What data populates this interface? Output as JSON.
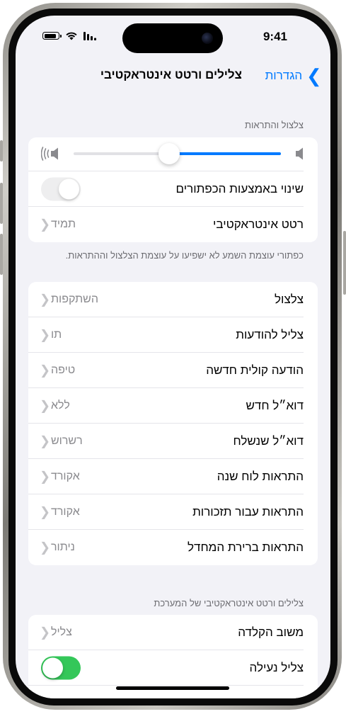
{
  "status_bar": {
    "time": "9:41"
  },
  "nav": {
    "back_label": "הגדרות",
    "title": "צלילים ורטט אינטראקטיבי"
  },
  "ringer_section": {
    "header": "צלצול והתראות",
    "volume_level": 0.46,
    "change_with_buttons": {
      "label": "שינוי באמצעות הכפתורים",
      "on": false
    },
    "haptics": {
      "label": "רטט אינטראקטיבי",
      "value": "תמיד"
    },
    "footer": "כפתורי עוצמת השמע לא ישפיעו על עוצמת הצלצול וההתראות."
  },
  "sounds_section": {
    "items": [
      {
        "label": "צלצול",
        "value": "השתקפות"
      },
      {
        "label": "צליל להודעות",
        "value": "תו"
      },
      {
        "label": "הודעה קולית חדשה",
        "value": "טיפה"
      },
      {
        "label": "דוא״ל חדש",
        "value": "ללא"
      },
      {
        "label": "דוא״ל שנשלח",
        "value": "רשרוש"
      },
      {
        "label": "התראות לוח שנה",
        "value": "אקורד"
      },
      {
        "label": "התראות עבור תזכורות",
        "value": "אקורד"
      },
      {
        "label": "התראות ברירת המחדל",
        "value": "ניתור"
      }
    ]
  },
  "system_section": {
    "header": "צלילים ורטט אינטראקטיבי של המערכת",
    "keyboard_feedback": {
      "label": "משוב הקלדה",
      "value": "צליל"
    },
    "lock_sound": {
      "label": "צליל נעילה",
      "on": true
    }
  },
  "colors": {
    "accent": "#007aff",
    "toggle_on": "#34c759",
    "background": "#f2f2f7"
  }
}
